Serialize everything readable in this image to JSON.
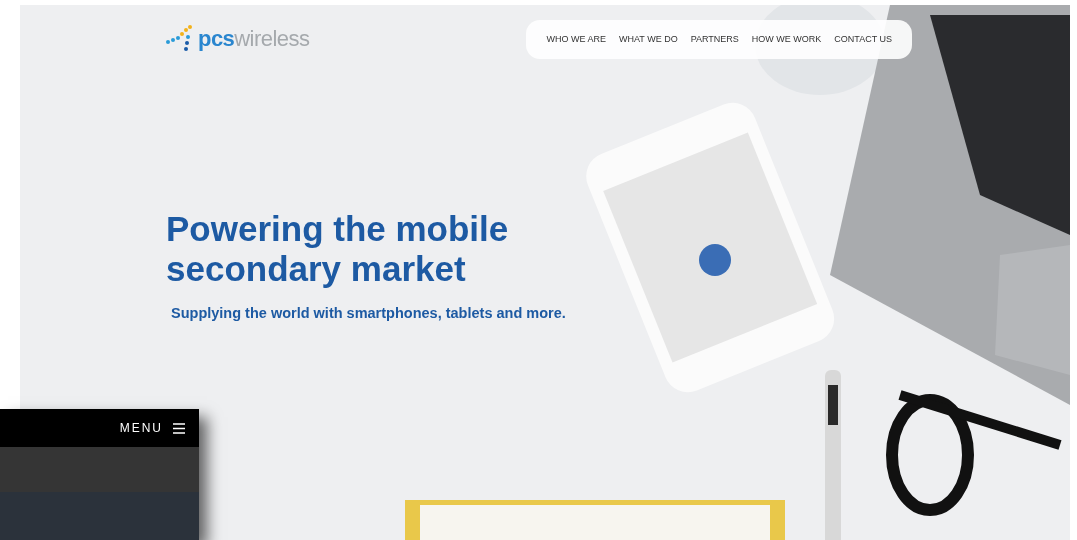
{
  "logo": {
    "bold": "pcs",
    "light": "wireless"
  },
  "nav": [
    "WHO WE ARE",
    "WHAT WE DO",
    "PARTNERS",
    "HOW WE WORK",
    "CONTACT US"
  ],
  "hero": {
    "title": "Powering the mobile secondary market",
    "subtitle": "Supplying the world with smartphones, tablets and more."
  },
  "menu_panel": {
    "label": "MENU"
  }
}
